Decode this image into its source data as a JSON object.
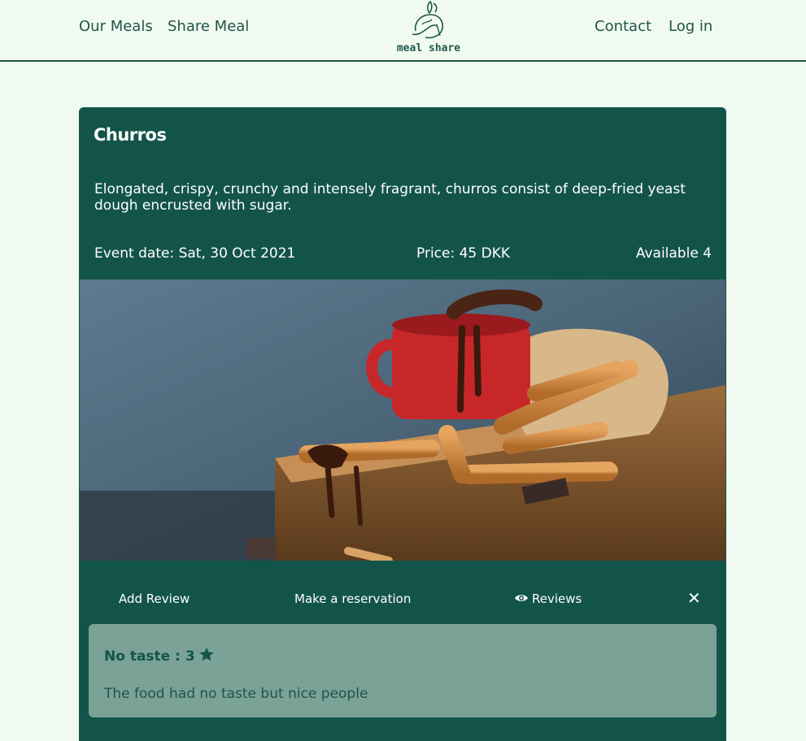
{
  "nav": {
    "left_links": [
      "Our Meals",
      "Share Meal"
    ],
    "right_links": [
      "Contact",
      "Log in"
    ],
    "logo_text": "meal share",
    "logo_icon": "leaf-hand-logo"
  },
  "meal": {
    "title": "Churros",
    "description": "Elongated, crispy, crunchy and intensely fragrant, churros consist of deep-fried yeast dough encrusted with sugar.",
    "event_date": "Event date: Sat, 30 Oct 2021",
    "price": "Price: 45 DKK",
    "available": "Available 4",
    "image": "churros-photo"
  },
  "actions": {
    "add_review": "Add Review",
    "make_reservation": "Make a reservation",
    "reviews": "Reviews",
    "reviews_icon": "eye-icon",
    "close": "✕"
  },
  "review": {
    "title": "No taste : 3",
    "rating": 3,
    "rating_icon": "star-icon",
    "body": "The food had no taste but nice people"
  },
  "colors": {
    "background": "#f1faf0",
    "card": "#13544a",
    "review_box": "#7ba297",
    "nav_text": "#1f5449"
  }
}
